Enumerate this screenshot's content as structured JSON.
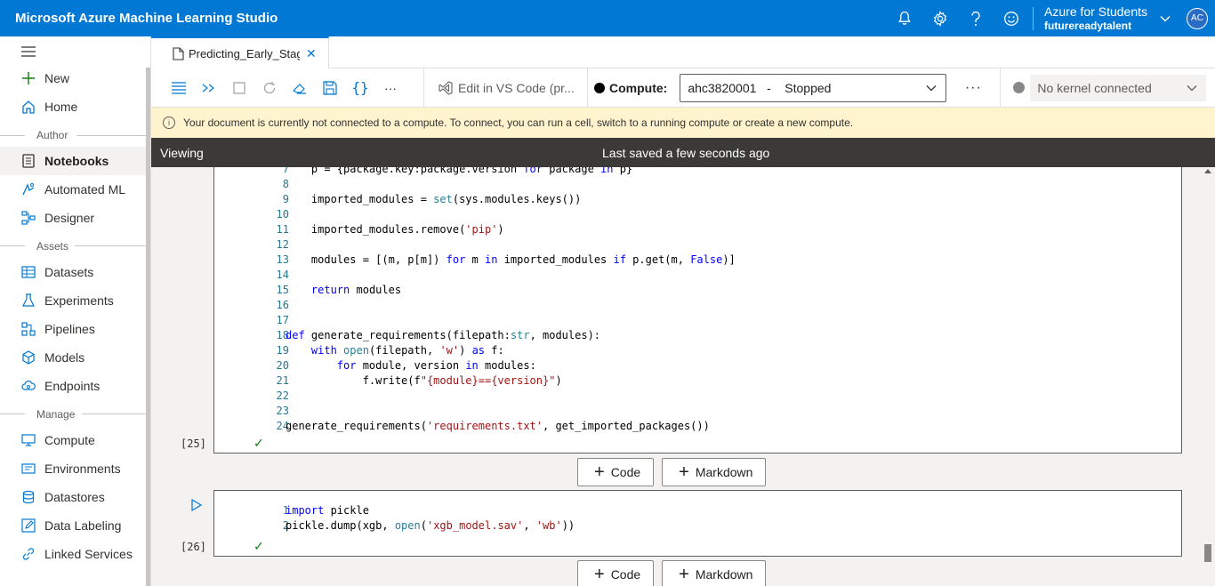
{
  "app": {
    "title": "Microsoft Azure Machine Learning Studio"
  },
  "header": {
    "account_name": "Azure for Students",
    "account_tenant": "futurereadytalent",
    "avatar_initials": "AC",
    "icons": [
      "bell-icon",
      "gear-icon",
      "help-icon",
      "smiley-icon"
    ]
  },
  "sidebar": {
    "items": [
      {
        "label": "New",
        "icon": "plus-icon"
      },
      {
        "label": "Home",
        "icon": "home-icon"
      },
      {
        "label": "Notebooks",
        "icon": "notebook-icon",
        "active": true
      },
      {
        "label": "Automated ML",
        "icon": "automl-icon"
      },
      {
        "label": "Designer",
        "icon": "designer-icon"
      },
      {
        "label": "Datasets",
        "icon": "datasets-icon"
      },
      {
        "label": "Experiments",
        "icon": "flask-icon"
      },
      {
        "label": "Pipelines",
        "icon": "pipeline-icon"
      },
      {
        "label": "Models",
        "icon": "cube-icon"
      },
      {
        "label": "Endpoints",
        "icon": "cloud-icon"
      },
      {
        "label": "Compute",
        "icon": "monitor-icon"
      },
      {
        "label": "Environments",
        "icon": "environment-icon"
      },
      {
        "label": "Datastores",
        "icon": "database-icon"
      },
      {
        "label": "Data Labeling",
        "icon": "edit-icon"
      },
      {
        "label": "Linked Services",
        "icon": "link-icon"
      }
    ],
    "sections": {
      "author": "Author",
      "assets": "Assets",
      "manage": "Manage"
    }
  },
  "tab": {
    "label": "Predicting_Early_Stag"
  },
  "toolbar": {
    "vscode_label": "Edit in VS Code (pr...",
    "compute_label": "Compute:",
    "compute_value": "ahc3820001   -    Stopped",
    "more_label": "···",
    "kernel_label": "No kernel connected"
  },
  "warning": {
    "text": "Your document is currently not connected to a compute. To connect, you can run a cell, switch to a running compute or create a new compute."
  },
  "status": {
    "mode": "Viewing",
    "saved": "Last saved a few seconds ago"
  },
  "cells": [
    {
      "exec_count": "[25]",
      "lines": [
        {
          "n": "7",
          "code": "    p = {package.key:package.version for package in p}"
        },
        {
          "n": "8",
          "code": ""
        },
        {
          "n": "9",
          "code": "    imported_modules = set(sys.modules.keys())"
        },
        {
          "n": "10",
          "code": ""
        },
        {
          "n": "11",
          "code": "    imported_modules.remove('pip')"
        },
        {
          "n": "12",
          "code": ""
        },
        {
          "n": "13",
          "code": "    modules = [(m, p[m]) for m in imported_modules if p.get(m, False)]"
        },
        {
          "n": "14",
          "code": ""
        },
        {
          "n": "15",
          "code": "    return modules"
        },
        {
          "n": "16",
          "code": ""
        },
        {
          "n": "17",
          "code": ""
        },
        {
          "n": "18",
          "code": "def generate_requirements(filepath:str, modules):"
        },
        {
          "n": "19",
          "code": "    with open(filepath, 'w') as f:"
        },
        {
          "n": "20",
          "code": "        for module, version in modules:"
        },
        {
          "n": "21",
          "code": "            f.write(f\"{module}=={version}\")"
        },
        {
          "n": "22",
          "code": ""
        },
        {
          "n": "23",
          "code": ""
        },
        {
          "n": "24",
          "code": "generate_requirements('requirements.txt', get_imported_packages())"
        }
      ]
    },
    {
      "exec_count": "[26]",
      "lines": [
        {
          "n": "1",
          "code": "import pickle"
        },
        {
          "n": "2",
          "code": "pickle.dump(xgb, open('xgb_model.sav', 'wb'))"
        }
      ]
    }
  ],
  "add_cell": {
    "code_label": "Code",
    "markdown_label": "Markdown"
  }
}
